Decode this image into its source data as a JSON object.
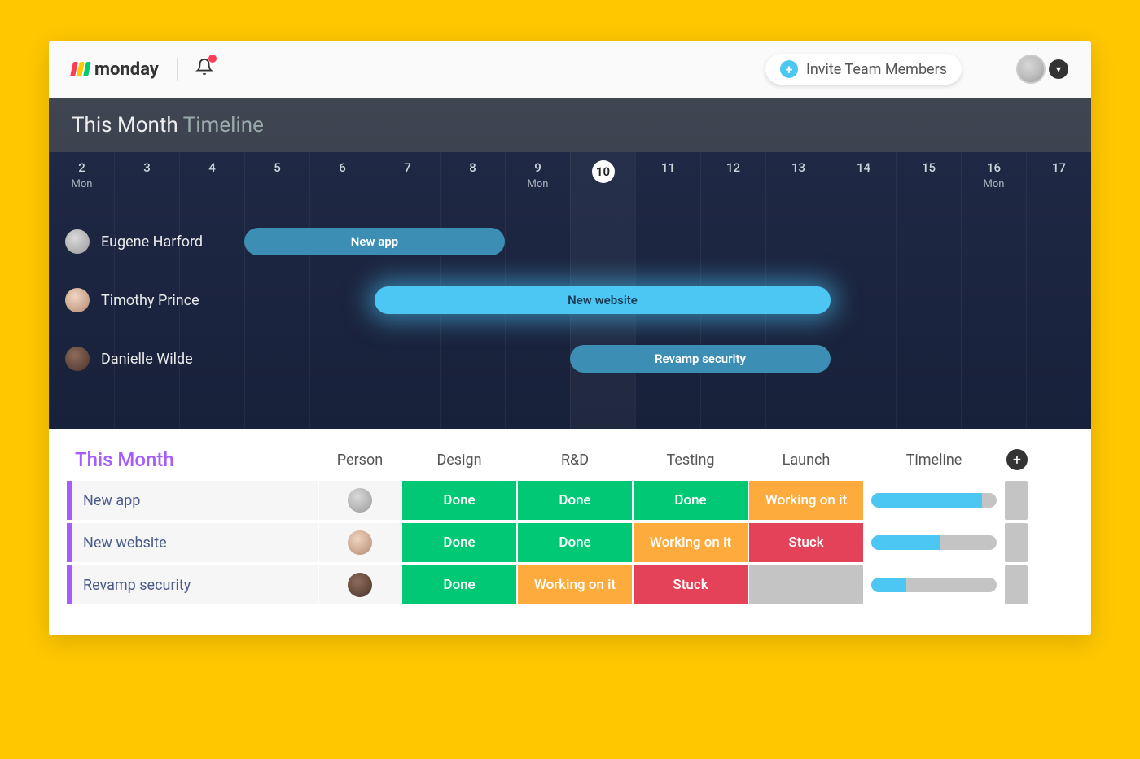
{
  "header": {
    "brand": "monday",
    "invite_label": "Invite Team Members"
  },
  "timeline": {
    "title_prefix": "This Month",
    "title_suffix": "Timeline",
    "current_day": 10,
    "days": [
      {
        "n": "2",
        "wk": "Mon"
      },
      {
        "n": "3"
      },
      {
        "n": "4"
      },
      {
        "n": "5"
      },
      {
        "n": "6"
      },
      {
        "n": "7"
      },
      {
        "n": "8"
      },
      {
        "n": "9",
        "wk": "Mon"
      },
      {
        "n": "10",
        "current": true
      },
      {
        "n": "11"
      },
      {
        "n": "12"
      },
      {
        "n": "13"
      },
      {
        "n": "14"
      },
      {
        "n": "15"
      },
      {
        "n": "16",
        "wk": "Mon"
      },
      {
        "n": "17"
      }
    ],
    "rows": [
      {
        "person": "Eugene Harford",
        "avatar": "m1",
        "bar": {
          "label": "New app",
          "start": 5,
          "end": 8,
          "highlight": false
        }
      },
      {
        "person": "Timothy Prince",
        "avatar": "m2",
        "bar": {
          "label": "New website",
          "start": 7,
          "end": 13,
          "highlight": true
        }
      },
      {
        "person": "Danielle Wilde",
        "avatar": "m3",
        "bar": {
          "label": "Revamp security",
          "start": 10,
          "end": 13,
          "highlight": false
        }
      }
    ]
  },
  "table": {
    "section_title": "This Month",
    "columns": [
      "Person",
      "Design",
      "R&D",
      "Testing",
      "Launch",
      "Timeline"
    ],
    "rows": [
      {
        "name": "New app",
        "avatar": "a1",
        "statuses": [
          "Done",
          "Done",
          "Done",
          "Working on it"
        ],
        "progress": 88
      },
      {
        "name": "New website",
        "avatar": "a2",
        "statuses": [
          "Done",
          "Done",
          "Working on it",
          "Stuck"
        ],
        "progress": 55
      },
      {
        "name": "Revamp security",
        "avatar": "a3",
        "statuses": [
          "Done",
          "Working on it",
          "Stuck",
          ""
        ],
        "progress": 28
      }
    ]
  },
  "status_colors": {
    "Done": "done",
    "Working on it": "working",
    "Stuck": "stuck",
    "": "empty"
  }
}
